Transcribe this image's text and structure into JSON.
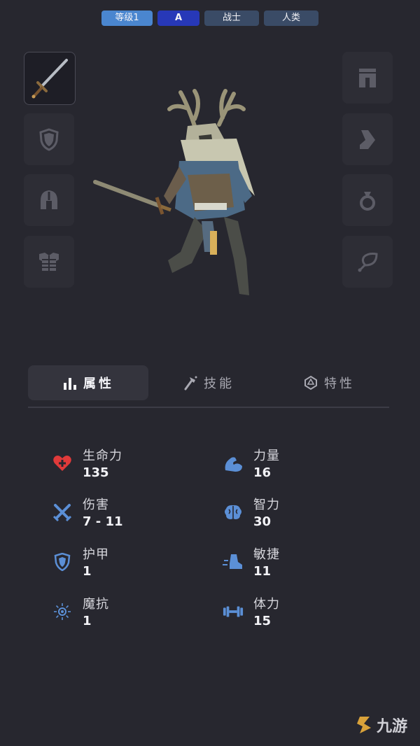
{
  "header": {
    "level": "等级1",
    "grade": "A",
    "class": "战士",
    "race": "人类"
  },
  "left_slots": [
    {
      "name": "weapon-slot",
      "icon": "sword-icon",
      "equipped": true
    },
    {
      "name": "offhand-slot",
      "icon": "shield-icon",
      "equipped": false
    },
    {
      "name": "helmet-slot",
      "icon": "helmet-icon",
      "equipped": false
    },
    {
      "name": "armor-slot",
      "icon": "chest-armor-icon",
      "equipped": false
    }
  ],
  "right_slots": [
    {
      "name": "pants-slot",
      "icon": "pants-icon",
      "equipped": false
    },
    {
      "name": "boots-slot",
      "icon": "boot-icon",
      "equipped": false
    },
    {
      "name": "ring-slot",
      "icon": "ring-icon",
      "equipped": false
    },
    {
      "name": "amulet-slot",
      "icon": "amulet-icon",
      "equipped": false
    }
  ],
  "tabs": [
    {
      "label": "属性",
      "icon": "bar-chart-icon",
      "active": true
    },
    {
      "label": "技能",
      "icon": "hammer-icon",
      "active": false
    },
    {
      "label": "特性",
      "icon": "dice-icon",
      "active": false
    }
  ],
  "stats": [
    {
      "label": "生命力",
      "value": "135",
      "icon": "heart-plus-icon"
    },
    {
      "label": "力量",
      "value": "16",
      "icon": "flexed-arm-icon"
    },
    {
      "label": "伤害",
      "value": "7 - 11",
      "icon": "crossed-swords-icon"
    },
    {
      "label": "智力",
      "value": "30",
      "icon": "brain-icon"
    },
    {
      "label": "护甲",
      "value": "1",
      "icon": "shield-icon"
    },
    {
      "label": "敏捷",
      "value": "11",
      "icon": "running-boot-icon"
    },
    {
      "label": "魔抗",
      "value": "1",
      "icon": "magic-burst-icon"
    },
    {
      "label": "体力",
      "value": "15",
      "icon": "dumbbell-icon"
    }
  ],
  "watermark": "九游",
  "colors": {
    "background": "#27272f",
    "tag_level": "#4a86cf",
    "tag_grade": "#2738b8",
    "tag_default": "#3a4b66",
    "stat_icon_blue": "#5b8fd6",
    "stat_icon_red": "#e03a3a"
  }
}
